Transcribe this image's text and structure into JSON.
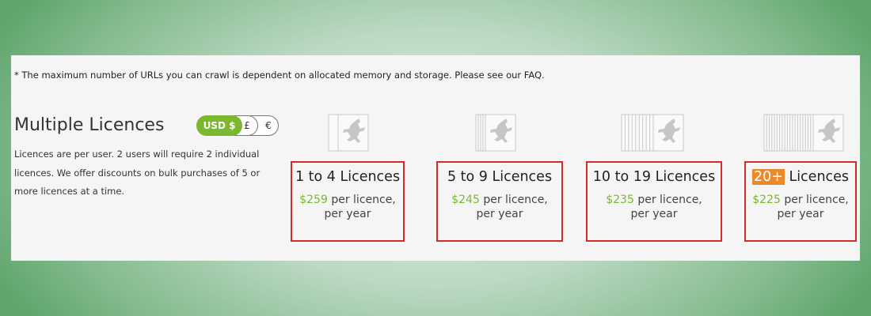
{
  "footnote": "* The maximum number of URLs you can crawl is dependent on allocated memory and storage. Please see our FAQ.",
  "section": {
    "title": "Multiple Licences",
    "description": "Licences are per user. 2 users will require 2 individual licences. We offer discounts on bulk purchases of 5 or more licences at a time."
  },
  "currency": {
    "selected": "USD $",
    "options": [
      "USD $",
      "£",
      "€"
    ]
  },
  "tiers": [
    {
      "title": "1 to 4 Licences",
      "price": "$259",
      "unit": "per licence,",
      "period": "per year",
      "stack_count": 2
    },
    {
      "title": "5 to 9 Licences",
      "price": "$245",
      "unit": "per licence,",
      "period": "per year",
      "stack_count": 5
    },
    {
      "title": "10 to 19 Licences",
      "price": "$235",
      "unit": "per licence,",
      "period": "per year",
      "stack_count": 10
    },
    {
      "title_highlight": "20+",
      "title_rest": " Licences",
      "price": "$225",
      "unit": "per licence,",
      "period": "per year",
      "stack_count": 20
    }
  ],
  "colors": {
    "accent": "#7cb82f",
    "highlight_box": "#d32a2a",
    "tag": "#ea8a2a"
  },
  "icon": "frog-logo-icon"
}
